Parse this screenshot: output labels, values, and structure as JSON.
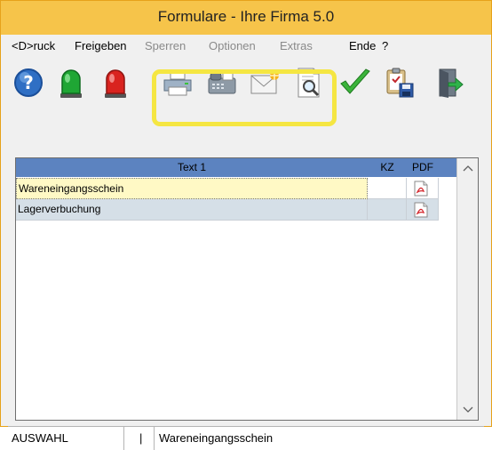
{
  "window": {
    "title": "Formulare - Ihre Firma 5.0"
  },
  "menu": {
    "items": [
      {
        "label": "<D>ruck",
        "dim": false
      },
      {
        "label": "Freigeben",
        "dim": false
      },
      {
        "label": "Sperren",
        "dim": true
      },
      {
        "label": "Optionen",
        "dim": true
      },
      {
        "label": "Extras",
        "dim": true
      },
      {
        "label": "Ende",
        "dim": false
      },
      {
        "label": "?",
        "dim": false
      }
    ]
  },
  "toolbar": {
    "buttons": [
      {
        "icon": "help-icon"
      },
      {
        "icon": "green-light-icon"
      },
      {
        "icon": "red-light-icon"
      },
      {
        "icon": "printer-icon"
      },
      {
        "icon": "fax-icon"
      },
      {
        "icon": "email-icon"
      },
      {
        "icon": "preview-icon"
      },
      {
        "icon": "checkmark-icon"
      },
      {
        "icon": "clipboard-save-icon"
      },
      {
        "icon": "exit-door-icon"
      }
    ],
    "highlight_color": "#f5e642"
  },
  "grid": {
    "columns": {
      "text1": "Text 1",
      "kz": "KZ",
      "pdf": "PDF"
    },
    "rows": [
      {
        "text1": "Wareneingangsschein",
        "kz": "",
        "pdf_icon": "pdf-icon",
        "selected": true
      },
      {
        "text1": "Lagerverbuchung",
        "kz": "",
        "pdf_icon": "pdf-icon",
        "selected": false
      }
    ],
    "header_color": "#5c83c0",
    "selected_row_color": "#fff9c5"
  },
  "statusbar": {
    "mode": "AUSWAHL",
    "separator": "|",
    "current": "Wareneingangsschein"
  }
}
